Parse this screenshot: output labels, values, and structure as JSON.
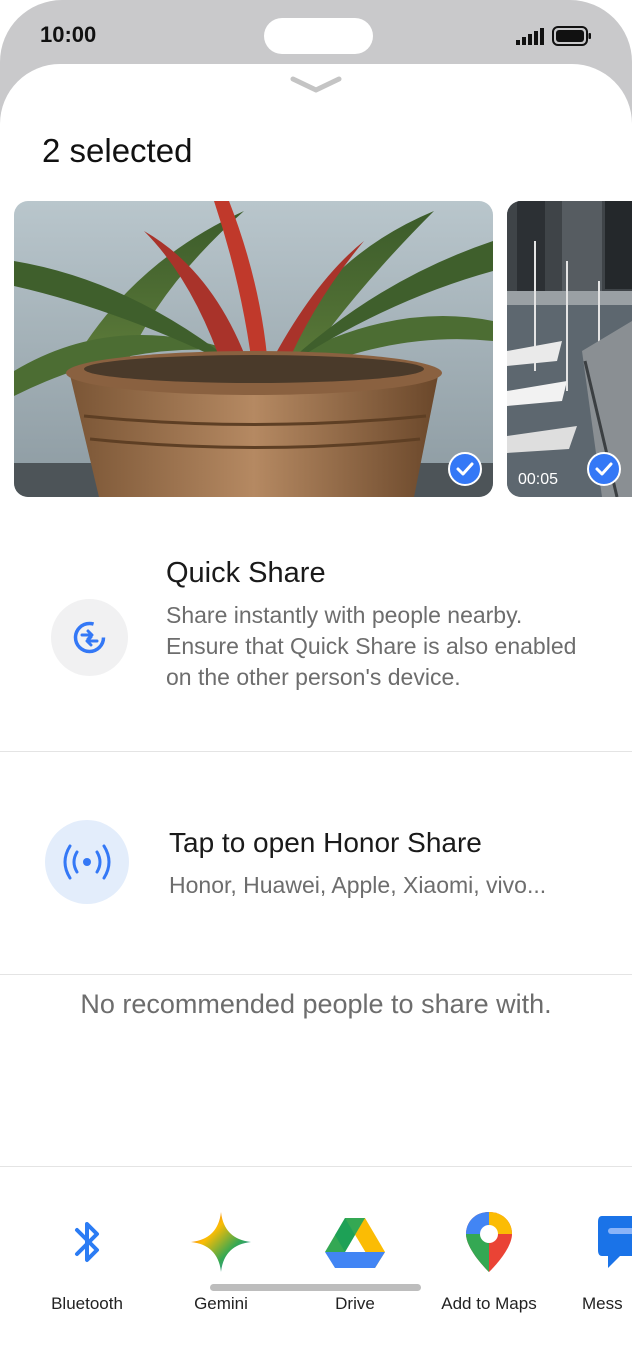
{
  "status": {
    "time": "10:00"
  },
  "sheet": {
    "title": "2 selected",
    "items": [
      {
        "type": "photo"
      },
      {
        "type": "video",
        "duration": "00:05"
      }
    ]
  },
  "quick_share": {
    "title": "Quick Share",
    "description": "Share instantly with people nearby. Ensure that Quick Share is also enabled on the other person's device."
  },
  "honor_share": {
    "title": "Tap to open Honor Share",
    "subtitle": "Honor, Huawei, Apple, Xiaomi, vivo..."
  },
  "recommendations": {
    "empty_text": "No recommended people to share with."
  },
  "apps": [
    {
      "label": "Bluetooth",
      "icon": "bluetooth-icon"
    },
    {
      "label": "Gemini",
      "icon": "gemini-icon"
    },
    {
      "label": "Drive",
      "icon": "drive-icon"
    },
    {
      "label": "Add to Maps",
      "icon": "maps-icon"
    },
    {
      "label": "Mess",
      "icon": "messages-icon"
    }
  ],
  "colors": {
    "accent": "#3478f6",
    "icon_bg": "#f1f1f2",
    "honor_bg": "#e3edfb"
  }
}
